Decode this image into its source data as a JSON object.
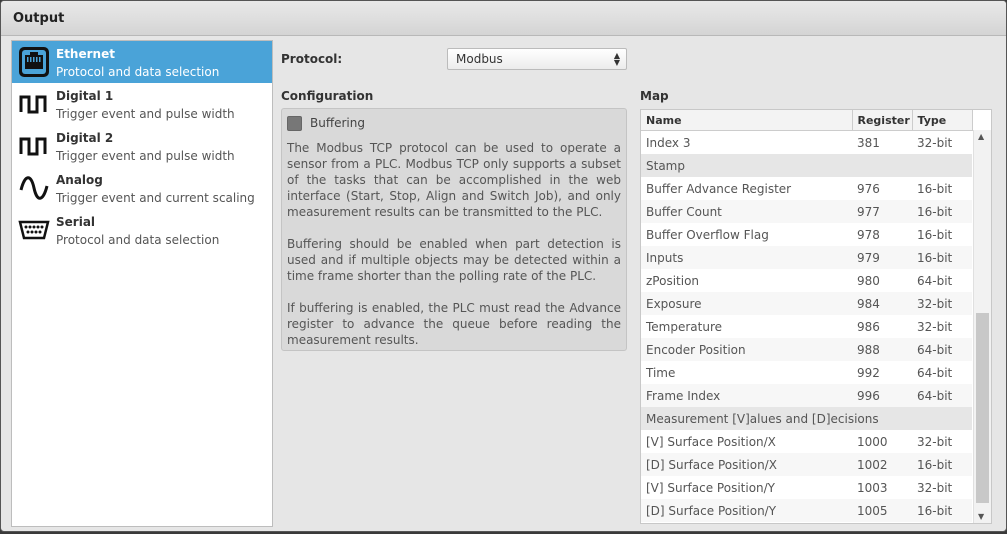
{
  "window": {
    "title": "Output"
  },
  "sidebar": {
    "items": [
      {
        "name": "Ethernet",
        "desc": "Protocol and data selection",
        "icon": "ethernet-icon"
      },
      {
        "name": "Digital 1",
        "desc": "Trigger event and pulse width",
        "icon": "pulse-icon"
      },
      {
        "name": "Digital 2",
        "desc": "Trigger event and pulse width",
        "icon": "pulse-icon"
      },
      {
        "name": "Analog",
        "desc": "Trigger event and current scaling",
        "icon": "sine-wave-icon"
      },
      {
        "name": "Serial",
        "desc": "Protocol and data selection",
        "icon": "serial-port-icon"
      }
    ]
  },
  "protocol": {
    "label": "Protocol:",
    "value": "Modbus"
  },
  "configuration": {
    "title": "Configuration",
    "buffering_label": "Buffering",
    "para1": "The Modbus TCP protocol can be used to operate a sensor from a PLC. Modbus TCP only supports a subset of the tasks that can be accomplished in the web interface (Start, Stop, Align and Switch Job), and only measurement results can be transmitted to the PLC.",
    "para2": "Buffering should be enabled when part detection is used and if multiple objects may be detected within a time frame shorter than the polling rate of the PLC.",
    "para3": "If buffering is enabled, the PLC must read the Advance register to advance the queue before reading the measurement results."
  },
  "map": {
    "title": "Map",
    "headers": {
      "name": "Name",
      "register": "Register",
      "type": "Type"
    },
    "rows": [
      {
        "name": "Index 3",
        "register": "381",
        "type": "32-bit"
      },
      {
        "group": "Stamp"
      },
      {
        "name": "Buffer Advance Register",
        "register": "976",
        "type": "16-bit"
      },
      {
        "name": "Buffer Count",
        "register": "977",
        "type": "16-bit"
      },
      {
        "name": "Buffer Overflow Flag",
        "register": "978",
        "type": "16-bit"
      },
      {
        "name": "Inputs",
        "register": "979",
        "type": "16-bit"
      },
      {
        "name": "zPosition",
        "register": "980",
        "type": "64-bit"
      },
      {
        "name": "Exposure",
        "register": "984",
        "type": "32-bit"
      },
      {
        "name": "Temperature",
        "register": "986",
        "type": "32-bit"
      },
      {
        "name": "Encoder Position",
        "register": "988",
        "type": "64-bit"
      },
      {
        "name": "Time",
        "register": "992",
        "type": "64-bit"
      },
      {
        "name": "Frame Index",
        "register": "996",
        "type": "64-bit"
      },
      {
        "group": "Measurement [V]alues and [D]ecisions"
      },
      {
        "name": "[V] Surface Position/X",
        "register": "1000",
        "type": "32-bit"
      },
      {
        "name": "[D] Surface Position/X",
        "register": "1002",
        "type": "16-bit"
      },
      {
        "name": "[V] Surface Position/Y",
        "register": "1003",
        "type": "32-bit"
      },
      {
        "name": "[D] Surface Position/Y",
        "register": "1005",
        "type": "16-bit"
      }
    ]
  }
}
